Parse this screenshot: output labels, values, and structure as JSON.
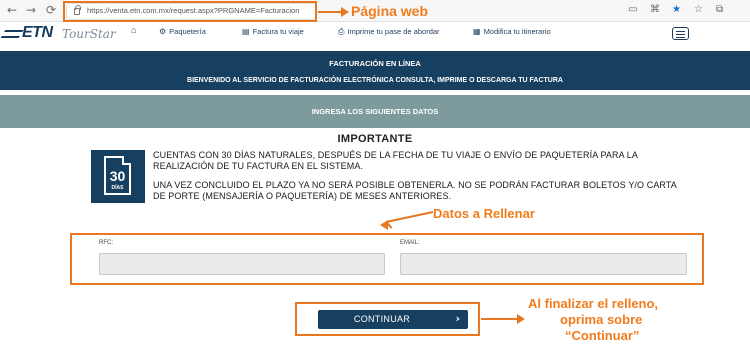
{
  "browser": {
    "url": "https://venta.etn.com.mx/request.aspx?PRGNAME=Facturacion",
    "back_icon": "←",
    "forward_icon": "→",
    "reload_icon": "⟳"
  },
  "annotations": {
    "web_label": "Página web",
    "fields_label": "Datos a Rellenar",
    "finish_line1": "Al finalizar el relleno,",
    "finish_line2": "oprima sobre",
    "finish_line3": "“Continuar”",
    "color": "#e87722"
  },
  "logo": {
    "brand": "ETN",
    "sub": "TourStar"
  },
  "nav": {
    "home_icon": "⌂",
    "items": [
      {
        "icon": "⚙",
        "label": "Paquetería"
      },
      {
        "icon": "▤",
        "label": "Factura tu viaje"
      },
      {
        "icon": "⎙",
        "label": "Imprime tu pase de abordar"
      },
      {
        "icon": "▦",
        "label": "Modifica tu itinerario"
      }
    ]
  },
  "banner": {
    "title": "FACTURACIÓN EN LÍNEA",
    "subtitle": "BIENVENIDO AL SERVICIO DE FACTURACIÓN ELECTRÓNICA CONSULTA, IMPRIME O DESCARGA TU FACTURA",
    "instruction": "INGRESA LOS SIGUIENTES DATOS"
  },
  "important": {
    "title": "IMPORTANTE",
    "icon_number": "30",
    "icon_word": "DÍAS",
    "p1": "CUENTAS CON 30 DÍAS NATURALES, DESPUÉS DE LA FECHA DE TU VIAJE O ENVÍO DE PAQUETERÍA PARA LA REALIZACIÓN DE TU FACTURA EN EL SISTEMA.",
    "p2": "UNA VEZ CONCLUIDO EL PLAZO YA NO SERÁ POSIBLE OBTENERLA. NO SE PODRÁN FACTURAR BOLETOS Y/O CARTA DE PORTE (MENSAJERÍA O PAQUETERÍA) DE MESES ANTERIORES."
  },
  "form": {
    "rfc_label": "RFC:",
    "rfc_value": "",
    "email_label": "EMAIL:",
    "email_value": ""
  },
  "continue_button": {
    "label": "CONTINUAR",
    "chevron": "›"
  },
  "colors": {
    "navy": "#173f5f",
    "teal_gray": "#7d9b9c",
    "orange": "#e87722"
  }
}
